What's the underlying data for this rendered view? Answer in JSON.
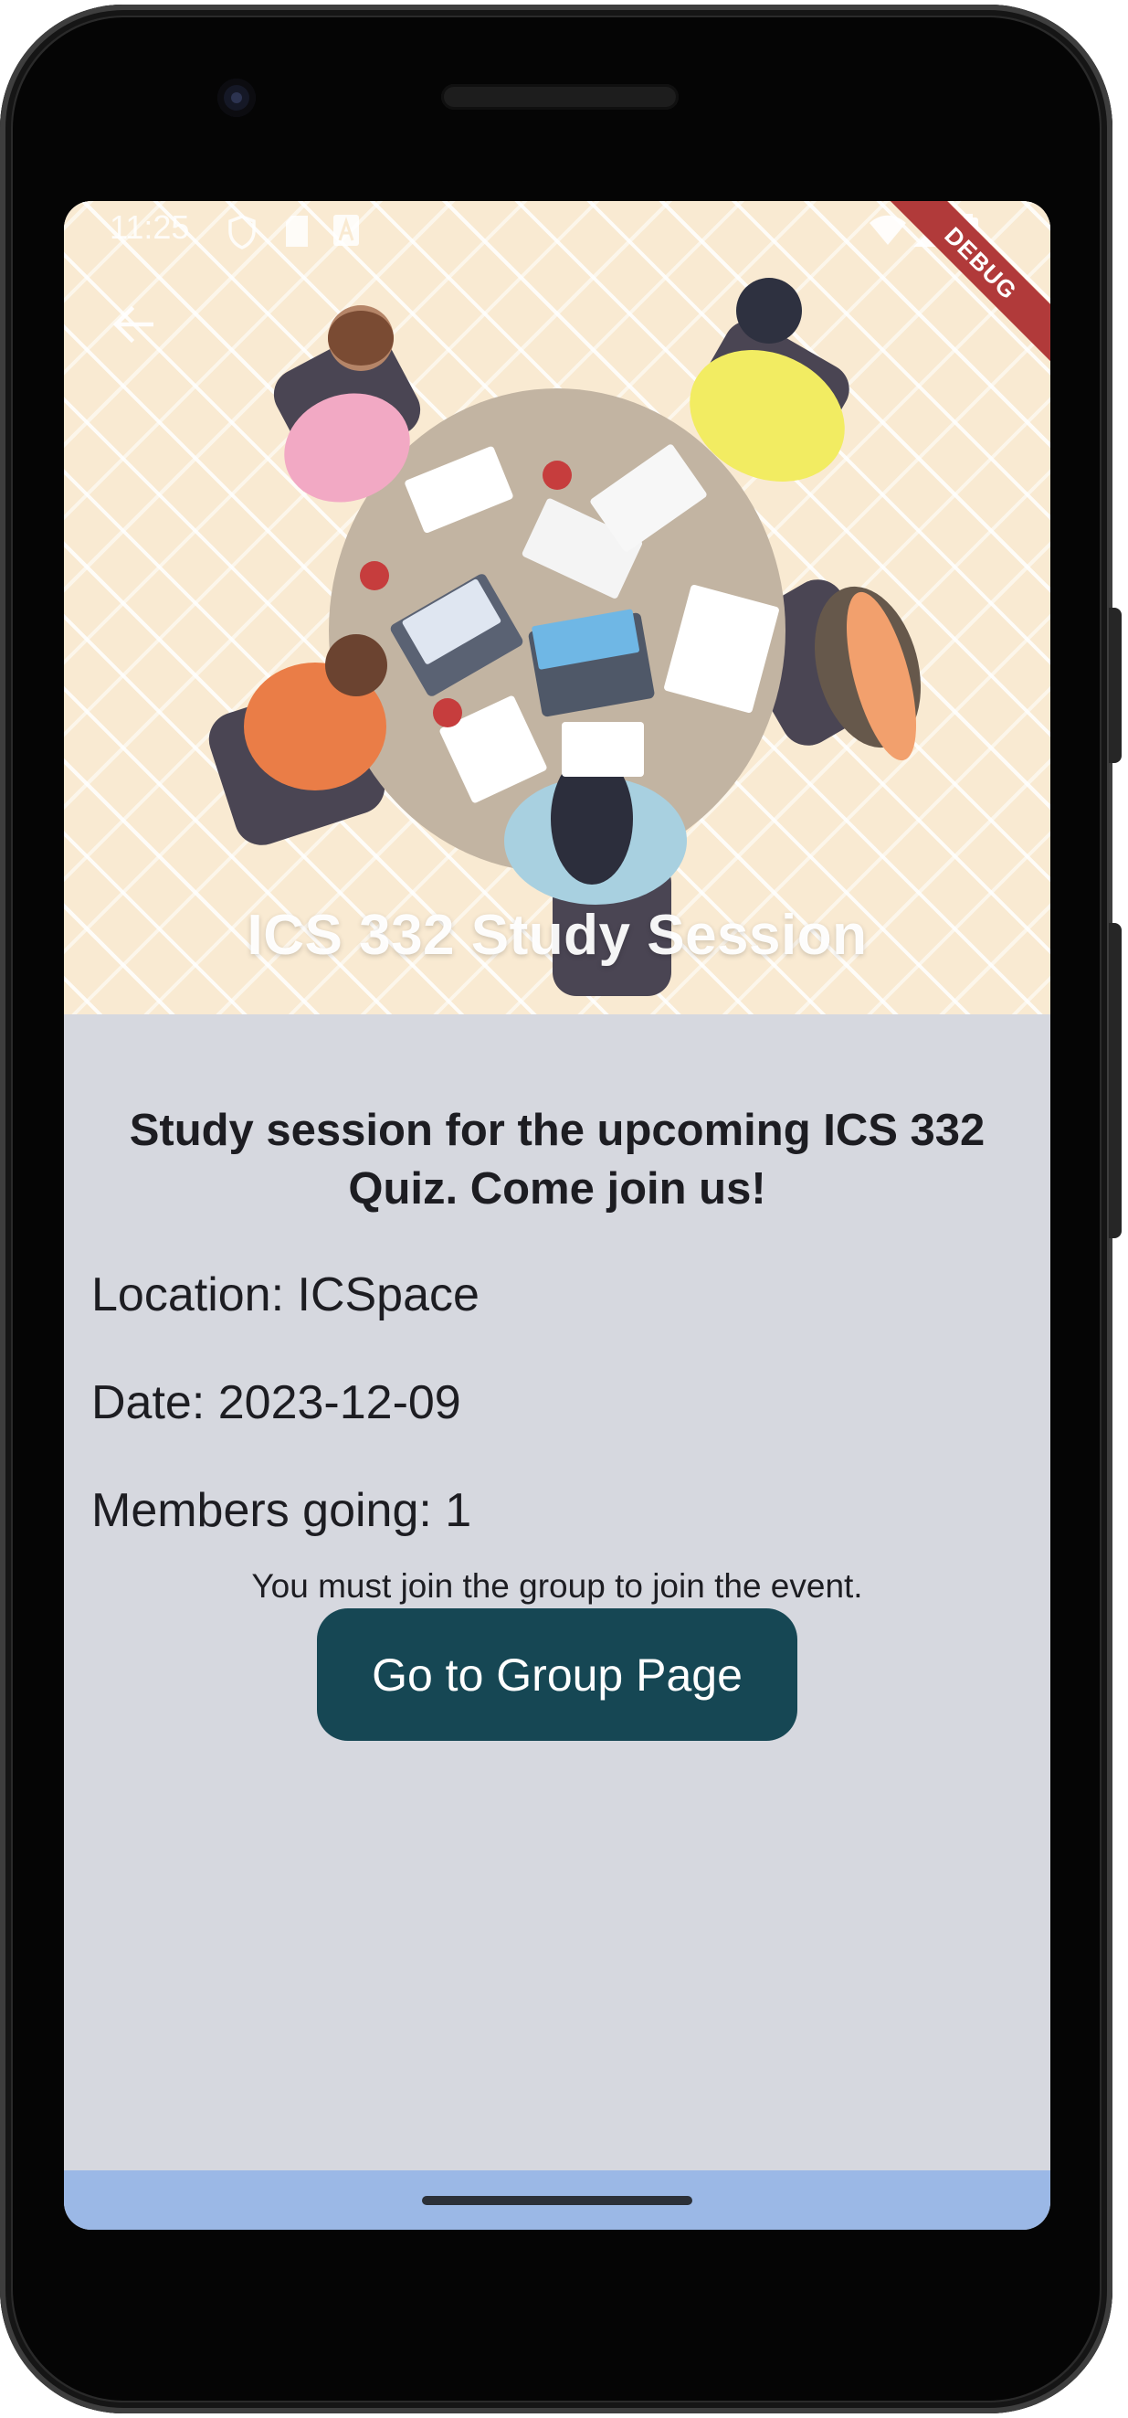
{
  "status_bar": {
    "time": "11:25",
    "icons": [
      "shield-icon",
      "sim-card-icon",
      "text-a-icon",
      "wifi-icon",
      "signal-icon",
      "battery-icon"
    ]
  },
  "app_bar": {
    "back_icon": "arrow-left-icon",
    "debug_banner": "DEBUG"
  },
  "event": {
    "title": "ICS 332 Study Session",
    "description": "Study session for the upcoming ICS 332 Quiz. Come join us!",
    "location": "Location: ICSpace",
    "date": "Date: 2023-12-09",
    "members": "Members going: 1",
    "join_notice": "You must join the group to join the event.",
    "group_button_label": "Go to Group Page"
  },
  "colors": {
    "hero_background": "#f9ead2",
    "content_background": "#d6d8df",
    "button": "#164754",
    "nav_bar": "#9bb8e6",
    "debug_banner": "#b13a3a"
  }
}
